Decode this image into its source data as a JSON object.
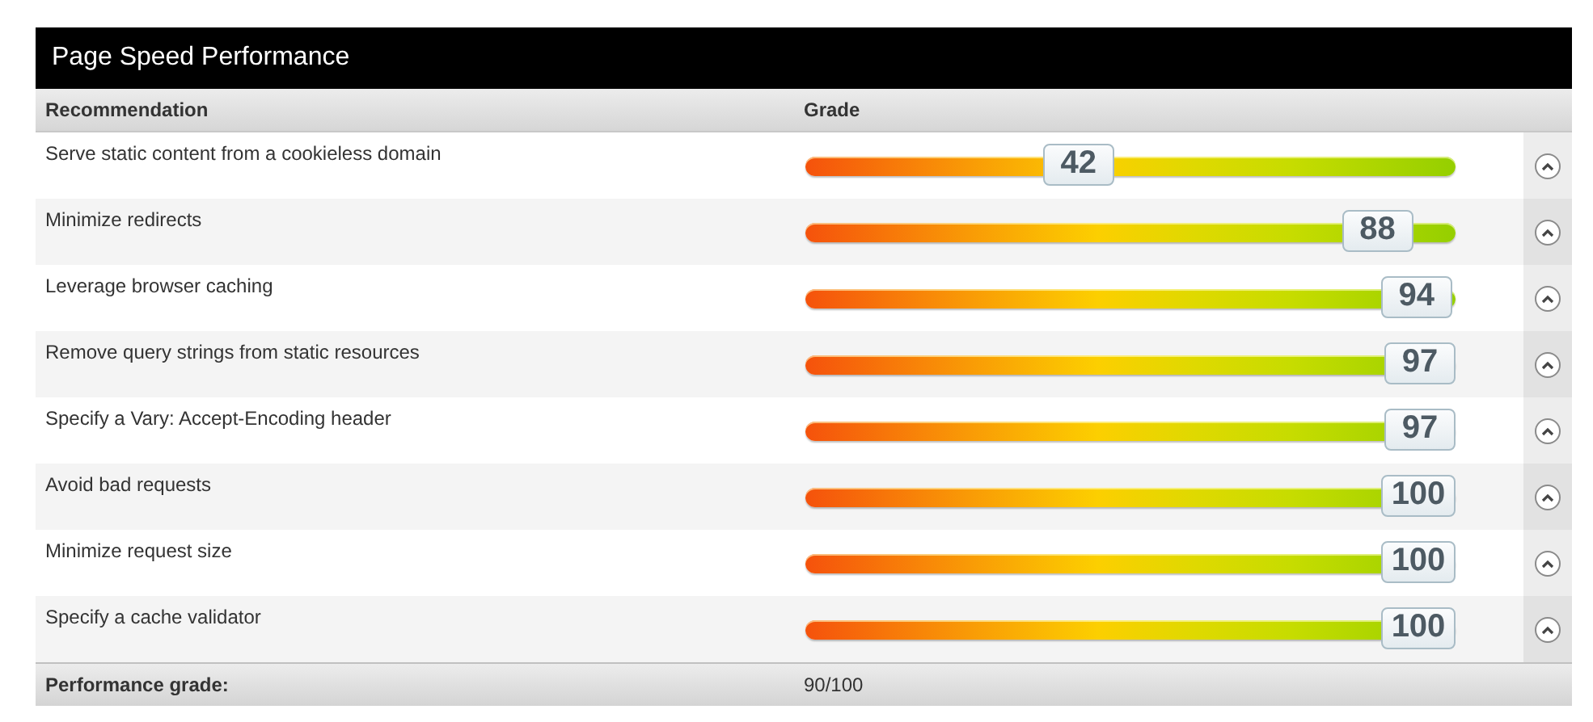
{
  "panel": {
    "title": "Page Speed Performance"
  },
  "columns": [
    "Recommendation",
    "Grade"
  ],
  "rows": [
    {
      "recommendation": "Serve static content from a cookieless domain",
      "grade": "42",
      "level": 0.42
    },
    {
      "recommendation": "Minimize redirects",
      "grade": "88",
      "level": 0.88
    },
    {
      "recommendation": "Leverage browser caching",
      "grade": "94",
      "level": 0.94
    },
    {
      "recommendation": "Remove query strings from static resources",
      "grade": "97",
      "level": 0.97
    },
    {
      "recommendation": "Specify a Vary: Accept-Encoding header",
      "grade": "97",
      "level": 0.97
    },
    {
      "recommendation": "Avoid bad requests",
      "grade": "100",
      "level": 1
    },
    {
      "recommendation": "Minimize request size",
      "grade": "100",
      "level": 1
    },
    {
      "recommendation": "Specify a cache validator",
      "grade": "100",
      "level": 1
    }
  ],
  "footer": {
    "label": "Performance grade:",
    "value": "90/100"
  }
}
